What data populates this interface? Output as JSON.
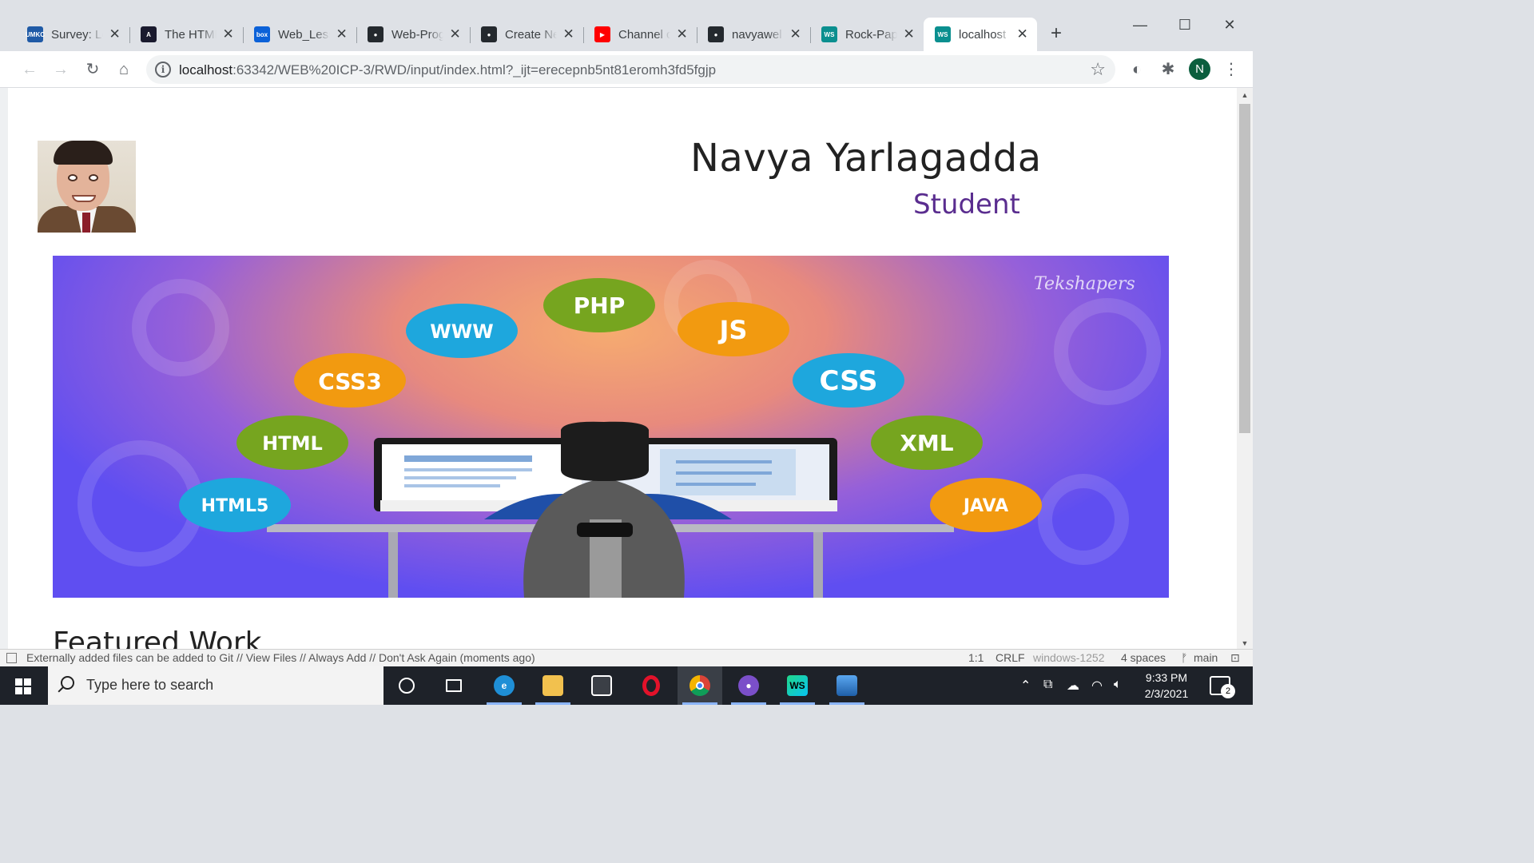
{
  "browser": {
    "tabs": [
      {
        "title": "Survey: Le",
        "favicon": "umkc-icon",
        "color": "#1f5aa6",
        "glyph": "UMKC",
        "active": false
      },
      {
        "title": "The HTML",
        "favicon": "angular-icon",
        "color": "#1a1a2e",
        "glyph": "A",
        "active": false
      },
      {
        "title": "Web_Less",
        "favicon": "box-icon",
        "color": "#0b61d8",
        "glyph": "box",
        "active": false
      },
      {
        "title": "Web-Prog",
        "favicon": "github-icon",
        "color": "#24292e",
        "glyph": "●",
        "active": false
      },
      {
        "title": "Create Ne",
        "favicon": "github-icon",
        "color": "#24292e",
        "glyph": "●",
        "active": false
      },
      {
        "title": "Channel c",
        "favicon": "youtube-icon",
        "color": "#ff0000",
        "glyph": "▶",
        "active": false
      },
      {
        "title": "navyawel",
        "favicon": "github-icon",
        "color": "#24292e",
        "glyph": "●",
        "active": false
      },
      {
        "title": "Rock-Pap",
        "favicon": "webstorm-icon",
        "color": "#0a8f8f",
        "glyph": "WS",
        "active": false
      },
      {
        "title": "localhost",
        "favicon": "webstorm-icon",
        "color": "#0a8f8f",
        "glyph": "WS",
        "active": true
      }
    ],
    "new_tab": "+",
    "window_controls": {
      "minimize": "—",
      "maximize": "☐",
      "close": "✕"
    },
    "url_host": "localhost",
    "url_rest": ":63342/WEB%20ICP-3/RWD/input/index.html?_ijt=erecepnb5nt81eromh3fd5fgjp",
    "profile_initial": "N"
  },
  "page": {
    "name": "Navya Yarlagadda",
    "role": "Student",
    "banner": {
      "watermark": "Tekshapers",
      "badges": [
        "PHP",
        "WWW",
        "JS",
        "CSS3",
        "CSS",
        "HTML",
        "XML",
        "HTML5",
        "JAVA"
      ]
    },
    "section_heading": "Featured Work"
  },
  "ide_status": {
    "message": "Externally added files can be added to Git // View Files // Always Add // Don't Ask Again (moments ago)",
    "position": "1:1",
    "line_sep": "CRLF",
    "encoding": "windows-1252",
    "indent": "4 spaces",
    "branch": "main"
  },
  "taskbar": {
    "search_placeholder": "Type here to search",
    "time": "9:33 PM",
    "date": "2/3/2021",
    "notifications": "2"
  },
  "colors": {
    "role_accent": "#5a2d8f",
    "banner_blue": "#5f4ef1",
    "banner_orange": "#f6ab70"
  }
}
